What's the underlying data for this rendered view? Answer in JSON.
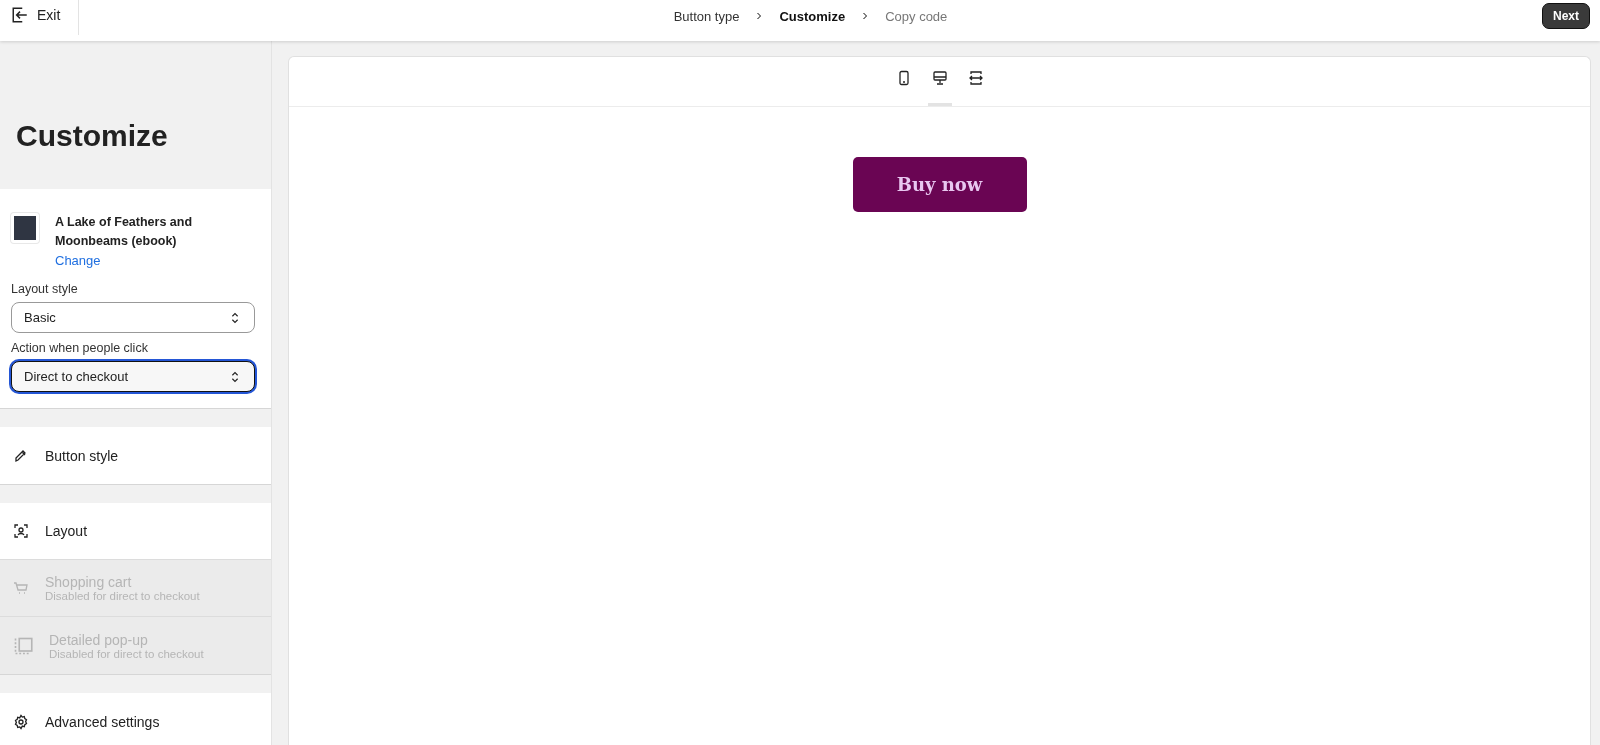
{
  "header": {
    "exit_label": "Exit",
    "steps": [
      {
        "label": "Button type",
        "selected": false,
        "done": true
      },
      {
        "label": "Customize",
        "selected": true,
        "done": false
      },
      {
        "label": "Copy code",
        "selected": false,
        "done": false
      }
    ],
    "next_label": "Next"
  },
  "sidebar": {
    "title": "Customize",
    "product": {
      "name": "A Lake of Feathers and Moonbeams (ebook)",
      "change_link": "Change"
    },
    "fields": [
      {
        "label": "Layout style",
        "value": "Basic",
        "focused": false
      },
      {
        "label": "Action when people click",
        "value": "Direct to checkout",
        "focused": true
      }
    ],
    "groups": [
      [
        {
          "kind": "brush",
          "label": "Button style",
          "disabled": false
        }
      ],
      [
        {
          "kind": "layout",
          "label": "Layout",
          "disabled": false
        },
        {
          "kind": "cart",
          "label": "Shopping cart",
          "note": "Disabled for direct to checkout",
          "disabled": true
        },
        {
          "kind": "popup",
          "label": "Detailed pop-up",
          "note": "Disabled for direct to checkout",
          "disabled": true
        }
      ],
      [
        {
          "kind": "gear",
          "label": "Advanced settings",
          "disabled": false
        }
      ]
    ]
  },
  "preview": {
    "devices": [
      {
        "kind": "mobile",
        "selected": false
      },
      {
        "kind": "desktop",
        "selected": true
      },
      {
        "kind": "fullwidth",
        "selected": false
      }
    ],
    "buy_button": {
      "label": "Buy now"
    }
  }
}
